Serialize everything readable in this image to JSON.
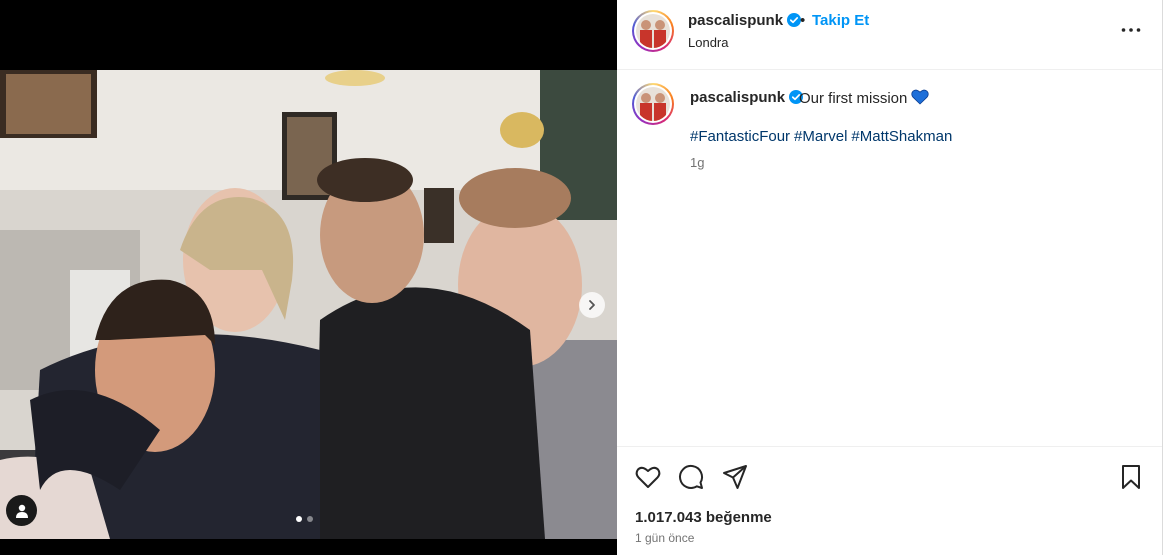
{
  "post": {
    "username": "pascalispunk",
    "separator": "•",
    "follow_label": "Takip Et",
    "location": "Londra",
    "caption": "Our first mission",
    "hashtags": [
      "#FantasticFour",
      "#Marvel",
      "#MattShakman"
    ],
    "caption_age": "1g",
    "likes": "1.017.043 beğenme",
    "posted_ago": "1 gün önce",
    "carousel": {
      "count": 2,
      "active_index": 0
    }
  },
  "icons": {
    "verified": "verified-badge-icon",
    "more": "more-options-icon",
    "next": "chevron-right-icon",
    "tag": "user-tag-icon",
    "like": "heart-icon",
    "comment": "comment-icon",
    "share": "share-icon",
    "save": "bookmark-icon",
    "emoji": "blue-heart-emoji"
  },
  "colors": {
    "accent": "#0095f6",
    "hashtag": "#00376b",
    "muted": "#737373",
    "text": "#262626",
    "verified": "#0095f6",
    "emoji_heart": "#1e6fd9"
  }
}
